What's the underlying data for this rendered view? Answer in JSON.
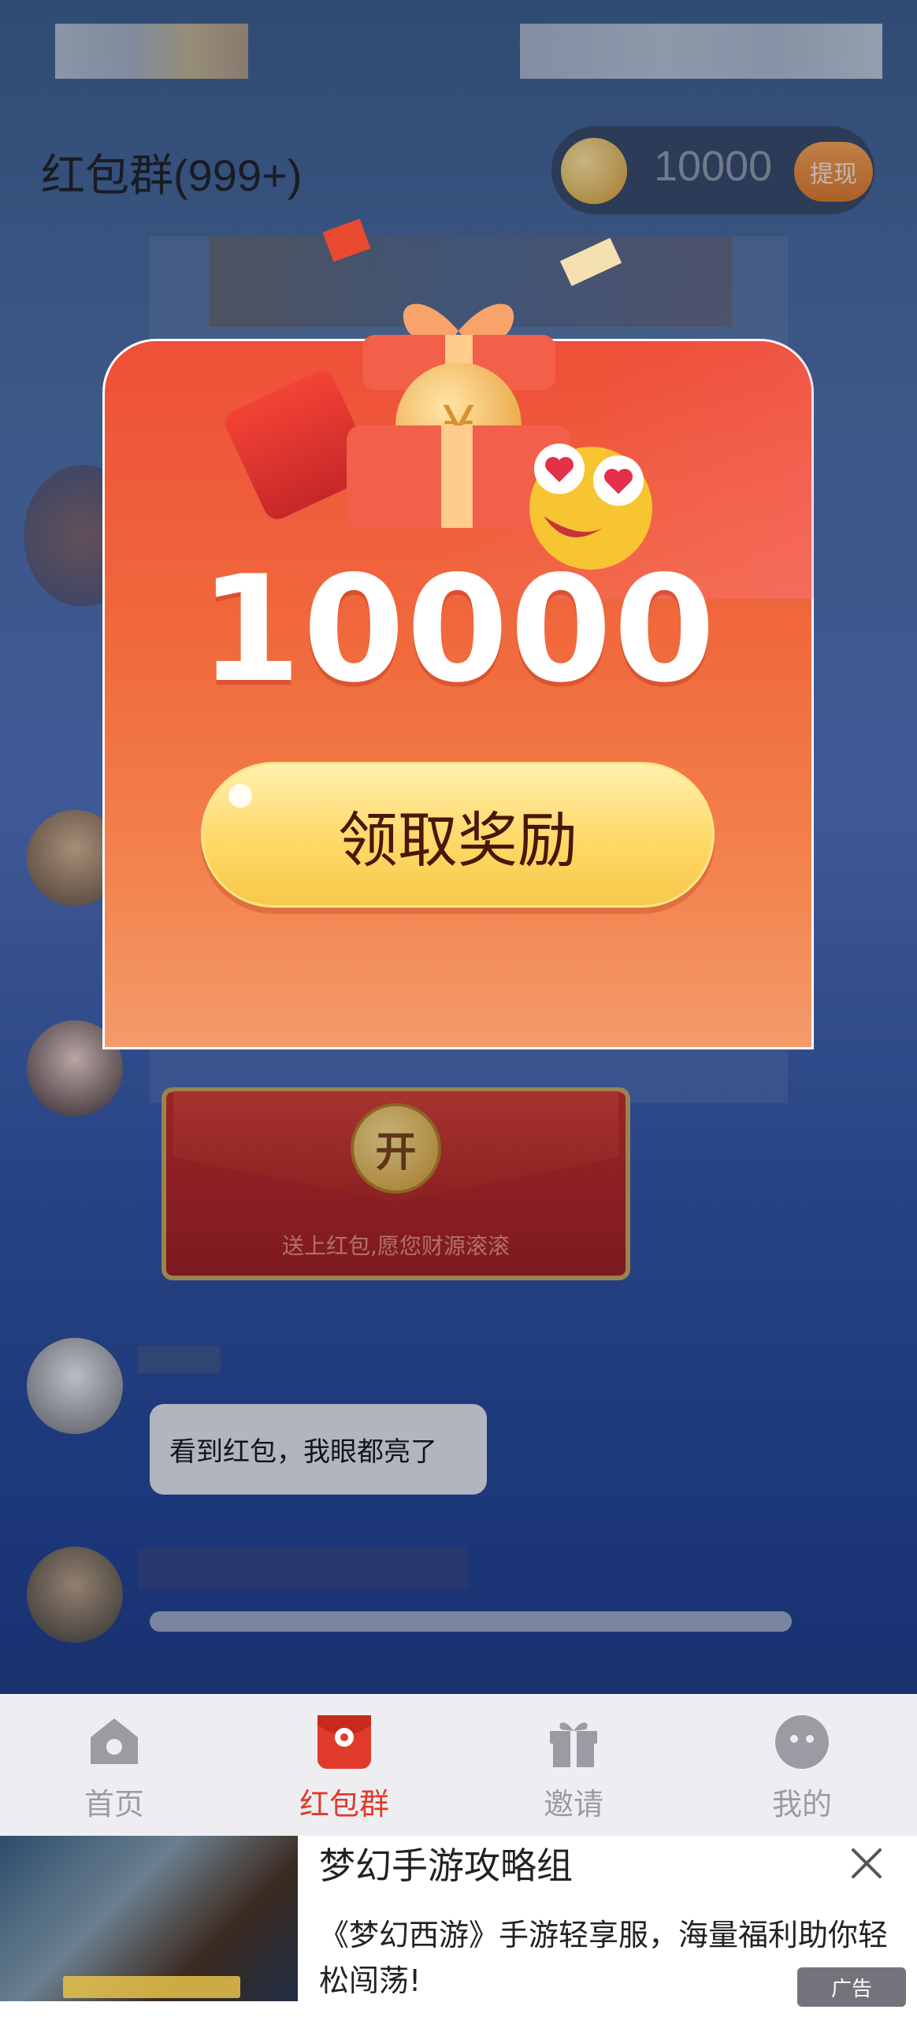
{
  "header": {
    "title": "红包群(999+)",
    "coin_balance": "10000",
    "withdraw_label": "提现"
  },
  "modal": {
    "reward_amount": "10000",
    "claim_button": "领取奖励"
  },
  "chat": {
    "sender_name": "",
    "envelope": {
      "open_label": "开",
      "wish": "送上红包,愿您财源滚滚"
    },
    "bubble_text": "看到红包，我眼都亮了"
  },
  "tabbar": {
    "items": [
      {
        "label": "首页",
        "icon": "home-icon"
      },
      {
        "label": "红包群",
        "icon": "red-packet-icon"
      },
      {
        "label": "邀请",
        "icon": "gift-icon"
      },
      {
        "label": "我的",
        "icon": "profile-icon"
      }
    ],
    "active_index": 1
  },
  "ad": {
    "title": "梦幻手游攻略组",
    "description": "《梦幻西游》手游轻享服，海量福利助你轻松闯荡!",
    "tag": "广告"
  },
  "colors": {
    "modal_red": "#ee4f38",
    "claim_yellow": "#ffd867",
    "active_tab": "#e03b2a"
  }
}
